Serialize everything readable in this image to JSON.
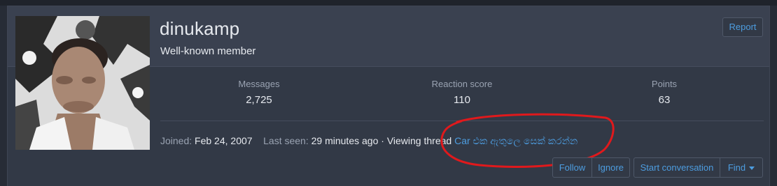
{
  "profile": {
    "username": "dinukamp",
    "user_title": "Well-known member",
    "report_label": "Report"
  },
  "stats": [
    {
      "label": "Messages",
      "value": "2,725"
    },
    {
      "label": "Reaction score",
      "value": "110"
    },
    {
      "label": "Points",
      "value": "63"
    }
  ],
  "activity": {
    "joined_label": "Joined:",
    "joined_value": "Feb 24, 2007",
    "last_seen_label": "Last seen:",
    "last_seen_value": "29 minutes ago",
    "separator": "·",
    "viewing_text": "Viewing thread",
    "thread_link": "Car එක ඇතුලෙ සෙක් කරන්න"
  },
  "actions": {
    "follow": "Follow",
    "ignore": "Ignore",
    "start_conversation": "Start conversation",
    "find": "Find"
  },
  "colors": {
    "background": "#272c36",
    "card": "#323946",
    "link": "#4d9de0",
    "annotation": "#e0191c"
  }
}
